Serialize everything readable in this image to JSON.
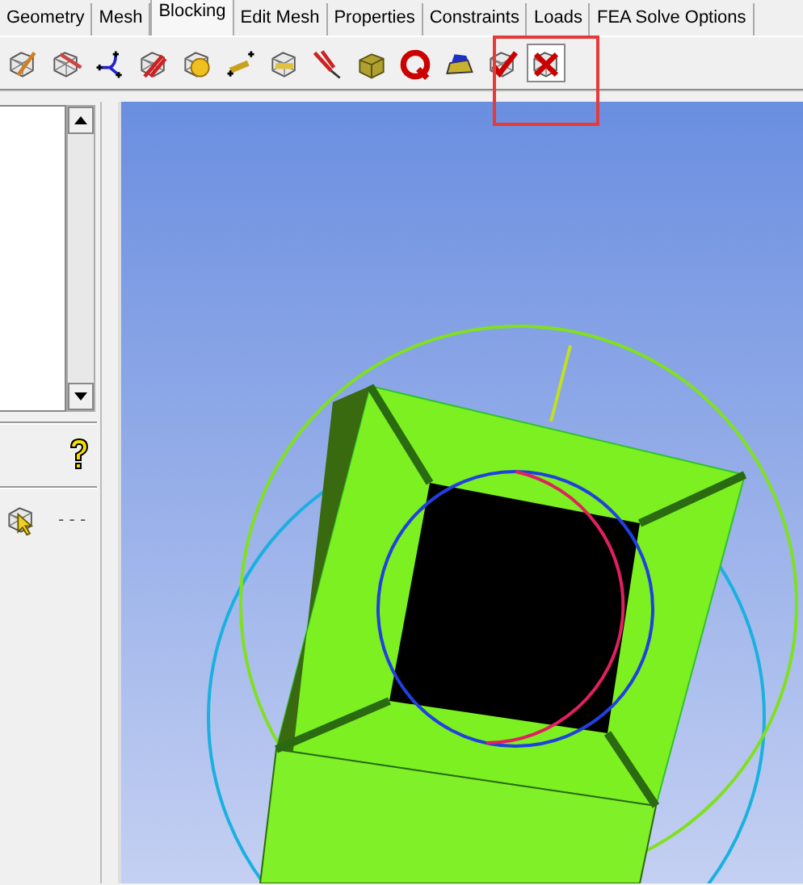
{
  "tabs": [
    {
      "label": "Geometry",
      "selected": false
    },
    {
      "label": "Mesh",
      "selected": false
    },
    {
      "label": "Blocking",
      "selected": true
    },
    {
      "label": "Edit Mesh",
      "selected": false
    },
    {
      "label": "Properties",
      "selected": false
    },
    {
      "label": "Constraints",
      "selected": false
    },
    {
      "label": "Loads",
      "selected": false
    },
    {
      "label": "FEA Solve Options",
      "selected": false
    }
  ],
  "toolbar": {
    "buttons": [
      {
        "selected": false
      },
      {
        "selected": false
      },
      {
        "selected": false
      },
      {
        "selected": false
      },
      {
        "selected": false
      },
      {
        "selected": false
      },
      {
        "selected": false
      },
      {
        "selected": false
      },
      {
        "selected": false
      },
      {
        "selected": false
      },
      {
        "selected": false
      },
      {
        "selected": false
      },
      {
        "selected": true
      }
    ],
    "highlight": true
  },
  "left_panel": {
    "more_label": "- - -"
  },
  "viewport": {
    "kind": "model"
  }
}
